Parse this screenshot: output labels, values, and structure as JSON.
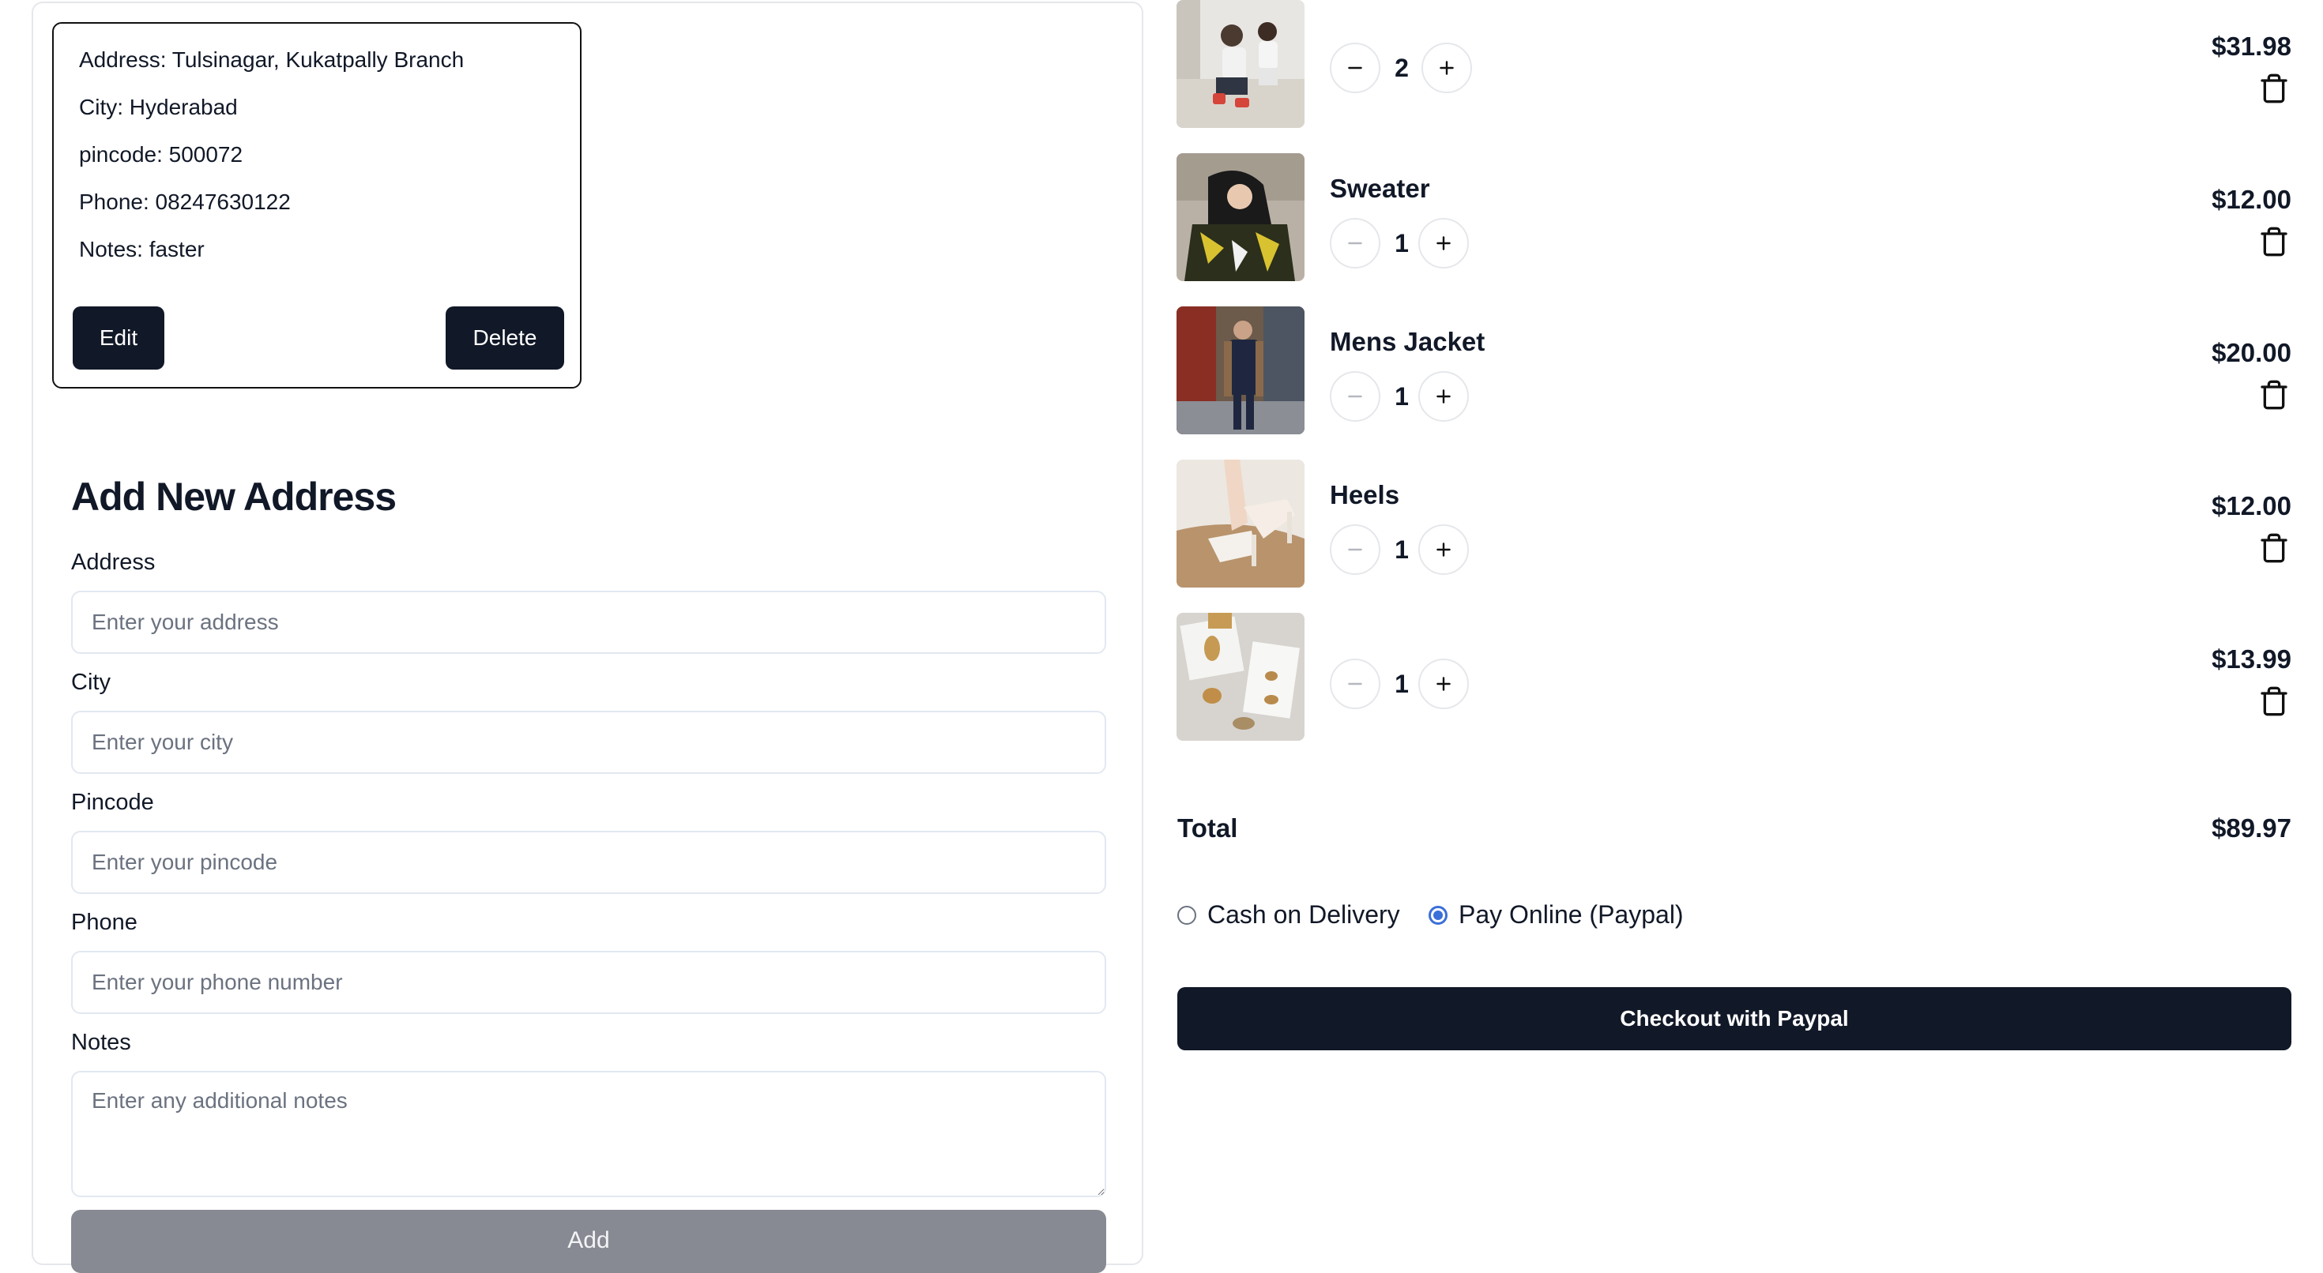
{
  "saved_address": {
    "address_line": "Address: Tulsinagar, Kukatpally Branch",
    "city_line": "City: Hyderabad",
    "pincode_line": "pincode: 500072",
    "phone_line": "Phone: 08247630122",
    "notes_line": "Notes: faster",
    "edit_label": "Edit",
    "delete_label": "Delete"
  },
  "add_address": {
    "heading": "Add New Address",
    "address_label": "Address",
    "address_placeholder": "Enter your address",
    "city_label": "City",
    "city_placeholder": "Enter your city",
    "pincode_label": "Pincode",
    "pincode_placeholder": "Enter your pincode",
    "phone_label": "Phone",
    "phone_placeholder": "Enter your phone number",
    "notes_label": "Notes",
    "notes_placeholder": "Enter any additional notes",
    "add_label": "Add"
  },
  "cart": {
    "items": [
      {
        "name": "",
        "quantity": "2",
        "price": "$31.98"
      },
      {
        "name": "Sweater",
        "quantity": "1",
        "price": "$12.00"
      },
      {
        "name": "Mens Jacket",
        "quantity": "1",
        "price": "$20.00"
      },
      {
        "name": "Heels",
        "quantity": "1",
        "price": "$12.00"
      },
      {
        "name": "",
        "quantity": "1",
        "price": "$13.99"
      }
    ],
    "total_label": "Total",
    "total_value": "$89.97"
  },
  "payment": {
    "options": [
      {
        "label": "Cash on Delivery",
        "selected": false
      },
      {
        "label": "Pay Online (Paypal)",
        "selected": true
      }
    ],
    "accent_color": "#3b6fd9",
    "checkout_label": "Checkout with Paypal"
  }
}
